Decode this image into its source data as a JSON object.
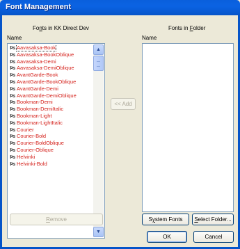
{
  "window": {
    "title": "Font Management"
  },
  "left_panel": {
    "heading_pre": "Fo",
    "heading_ul": "n",
    "heading_post": "ts in KK Direct Dev",
    "column_header": "Name",
    "font_icon": "font-file-icon",
    "items": [
      "Aavasaksa-Book",
      "Aavasaksa-BookOblique",
      "Aavasaksa-Demi",
      "Aavasaksa-DemiOblique",
      "AvantGarde-Book",
      "AvantGarde-BookOblique",
      "AvantGarde-Demi",
      "AvantGarde-DemiOblique",
      "Bookman-Demi",
      "Bookman-DemiItalic",
      "Bookman-Light",
      "Bookman-LightItalic",
      "Courier",
      "Courier-Bold",
      "Courier-BoldOblique",
      "Courier-Oblique",
      "Helvinki",
      "Helvinki-Bold"
    ],
    "selected_index": 0,
    "item_color": "#d4201a"
  },
  "right_panel": {
    "heading_pre": "Fonts in ",
    "heading_ul": "F",
    "heading_post": "older",
    "column_header": "Name"
  },
  "buttons": {
    "add": "<< Add",
    "remove_ul": "R",
    "remove_post": "emove",
    "system_fonts_pre": "S",
    "system_fonts_ul": "y",
    "system_fonts_post": "stem Fonts",
    "select_folder_pre": "",
    "select_folder_ul": "S",
    "select_folder_post": "elect Folder...",
    "ok": "OK",
    "cancel": "Cancel"
  },
  "colors": {
    "titlebar": "#0b63e3",
    "dialog_bg": "#ece9d8"
  }
}
